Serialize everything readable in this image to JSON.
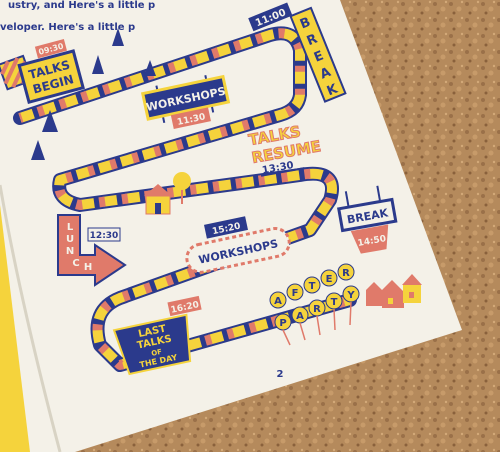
{
  "intro_text": [
    "ustry, and  Here's a little p",
    "veloper. Here's a little p"
  ],
  "schedule": {
    "talks_begin": {
      "time": "09:30",
      "label_line1": "TALKS",
      "label_line2": "BEGIN"
    },
    "workshops_morning": {
      "label": "WORKSHOPS",
      "time": "11:30"
    },
    "break_1": {
      "time": "11:00",
      "letters": [
        "B",
        "R",
        "E",
        "A",
        "K"
      ]
    },
    "talks_resume": {
      "label_line1": "TALKS",
      "label_line2": "RESUME",
      "time": "13:30"
    },
    "lunch": {
      "letters": [
        "L",
        "U",
        "N",
        "C",
        "H"
      ],
      "time": "12:30"
    },
    "break_2": {
      "label": "BREAK",
      "time": "14:50"
    },
    "workshops_afternoon": {
      "time": "15:20",
      "label": "WORKSHOPS"
    },
    "after_party": {
      "letters": [
        "A",
        "F",
        "T",
        "E",
        "R",
        "P",
        "A",
        "R",
        "T",
        "Y"
      ]
    },
    "last_talks": {
      "line1": "LAST",
      "line2": "TALKS",
      "line3": "OF",
      "line4": "THE DAY",
      "time": "16:20"
    }
  },
  "page_number": "2",
  "colors": {
    "navy": "#2b3a8c",
    "yellow": "#f5d33c",
    "coral": "#e07a6a",
    "cream": "#f4f1e8",
    "cork": "#b58a5c"
  }
}
